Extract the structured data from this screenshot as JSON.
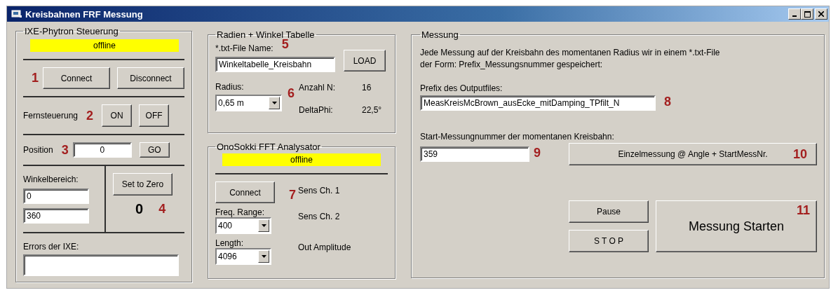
{
  "window": {
    "title": "Kreisbahnen FRF Messung"
  },
  "ixe": {
    "title": "IXE-Phytron Steuerung",
    "status": "offline",
    "callout": "1",
    "buttons": [
      "Connect",
      "Disconnect"
    ],
    "remote": {
      "label": "Fernsteuerung",
      "callout": "2",
      "buttons": [
        "ON",
        "OFF"
      ]
    },
    "position": {
      "label": "Position",
      "callout": "3",
      "value": "0",
      "button": "GO"
    },
    "range": {
      "label": "Winkelbereich:",
      "from": "0",
      "to": "360"
    },
    "zero": {
      "button": "Set to Zero",
      "value": "0",
      "callout": "4"
    },
    "errors": {
      "label": "Errors der IXE:"
    }
  },
  "table": {
    "title": "Radien + Winkel Tabelle",
    "file_label": "*.txt-File Name:",
    "callout": "5",
    "file": "Winkeltabelle_Kreisbahn",
    "load": "LOAD",
    "radius_label": "Radius:",
    "radius": "0,65 m",
    "callout_radius": "6",
    "info": [
      {
        "label": "Anzahl N:",
        "value": "16"
      },
      {
        "label": "DeltaPhi:",
        "value": "22,5°"
      }
    ]
  },
  "fft": {
    "title": "OnoSokki FFT Analysator",
    "status": "offline",
    "connect": "Connect",
    "callout": "7",
    "freq_label": "Freq. Range:",
    "freq": "400",
    "length_label": "Length:",
    "length": "4096",
    "sens": [
      "Sens Ch. 1",
      "Sens Ch. 2",
      "Out Amplitude"
    ]
  },
  "measure": {
    "title": "Messung",
    "description": "Jede Messung auf der Kreisbahn des momentanen Radius wir in einem *.txt-File der Form: Prefix_Messungsnummer gespeichert:",
    "prefix_label": "Prefix des Outputfiles:",
    "prefix": "MeasKreisMcBrown_ausEcke_mitDamping_TPfilt_N",
    "callout_prefix": "8",
    "start_label": "Start-Messungnummer der momentanen Kreisbahn:",
    "start": "359",
    "callout_start": "9",
    "single": "Einzelmessung  @ Angle + StartMessNr.",
    "callout_single": "10",
    "pause": "Pause",
    "stop": "S T O P",
    "run": "Messung Starten",
    "callout_run": "11"
  }
}
